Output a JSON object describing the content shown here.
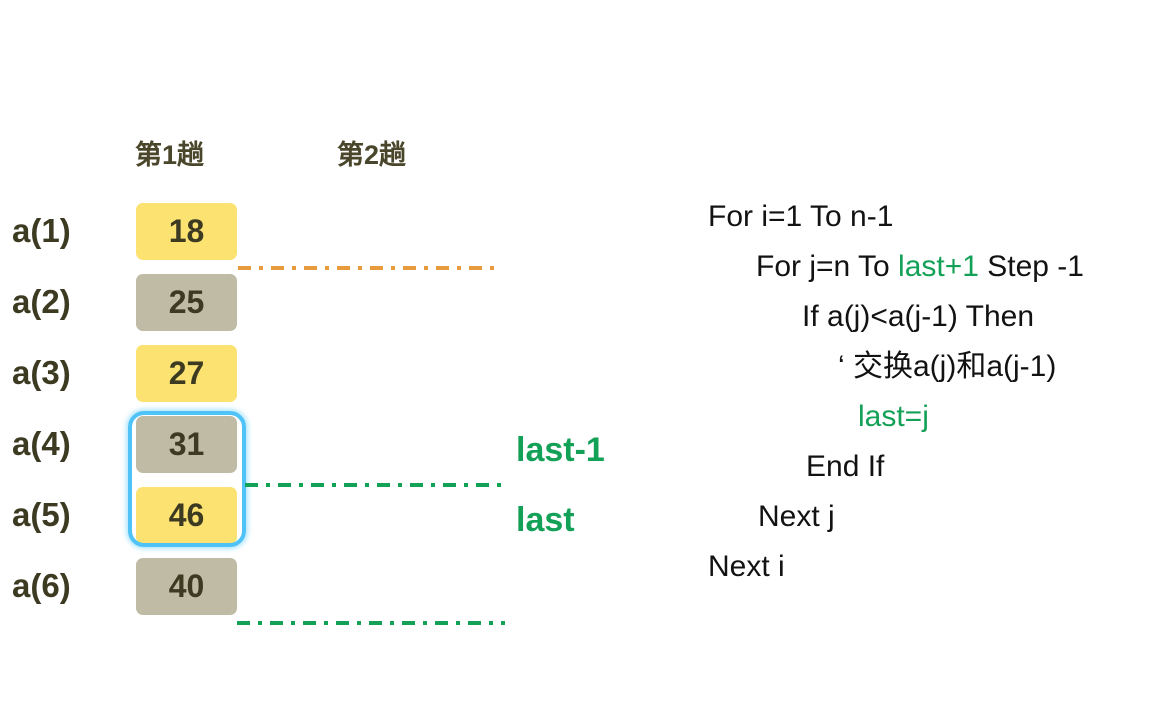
{
  "headers": {
    "pass1": "第1趟",
    "pass2": "第2趟"
  },
  "colors": {
    "highlight_yellow": "#FBE271",
    "neutral_gray": "#BFBBA4",
    "text_dark": "#3D3A22",
    "accent_green": "#13A157",
    "accent_orange": "#E79B3C",
    "selection_blue": "#4FC3F7"
  },
  "array": {
    "rows": [
      {
        "index_label": "a(1)",
        "value": "18",
        "fill": "yellow"
      },
      {
        "index_label": "a(2)",
        "value": "25",
        "fill": "gray"
      },
      {
        "index_label": "a(3)",
        "value": "27",
        "fill": "yellow"
      },
      {
        "index_label": "a(4)",
        "value": "31",
        "fill": "gray"
      },
      {
        "index_label": "a(5)",
        "value": "46",
        "fill": "yellow"
      },
      {
        "index_label": "a(6)",
        "value": "40",
        "fill": "gray"
      }
    ]
  },
  "annotations": {
    "last_minus_1": "last-1",
    "last": "last"
  },
  "code": {
    "lines": [
      {
        "indent": 0,
        "segments": [
          {
            "text": "For i=1 To n-1",
            "style": "plain"
          }
        ]
      },
      {
        "indent": 1,
        "segments": [
          {
            "text": "For j=n To ",
            "style": "plain"
          },
          {
            "text": "last+1",
            "style": "green"
          },
          {
            "text": " Step -1",
            "style": "plain"
          }
        ]
      },
      {
        "indent": 2,
        "segments": [
          {
            "text": "If a(j)<a(j-1) Then",
            "style": "plain"
          }
        ]
      },
      {
        "indent": 3,
        "segments": [
          {
            "text": "‘ 交换a(j)和a(j-1)",
            "style": "plain"
          }
        ]
      },
      {
        "indent": 4,
        "segments": [
          {
            "text": "last=j",
            "style": "green"
          }
        ]
      },
      {
        "indent": 5,
        "segments": [
          {
            "text": "End If",
            "style": "plain"
          }
        ]
      },
      {
        "indent": 6,
        "segments": [
          {
            "text": "Next j",
            "style": "plain"
          }
        ]
      },
      {
        "indent": 7,
        "segments": [
          {
            "text": "Next i",
            "style": "plain"
          }
        ]
      }
    ]
  }
}
